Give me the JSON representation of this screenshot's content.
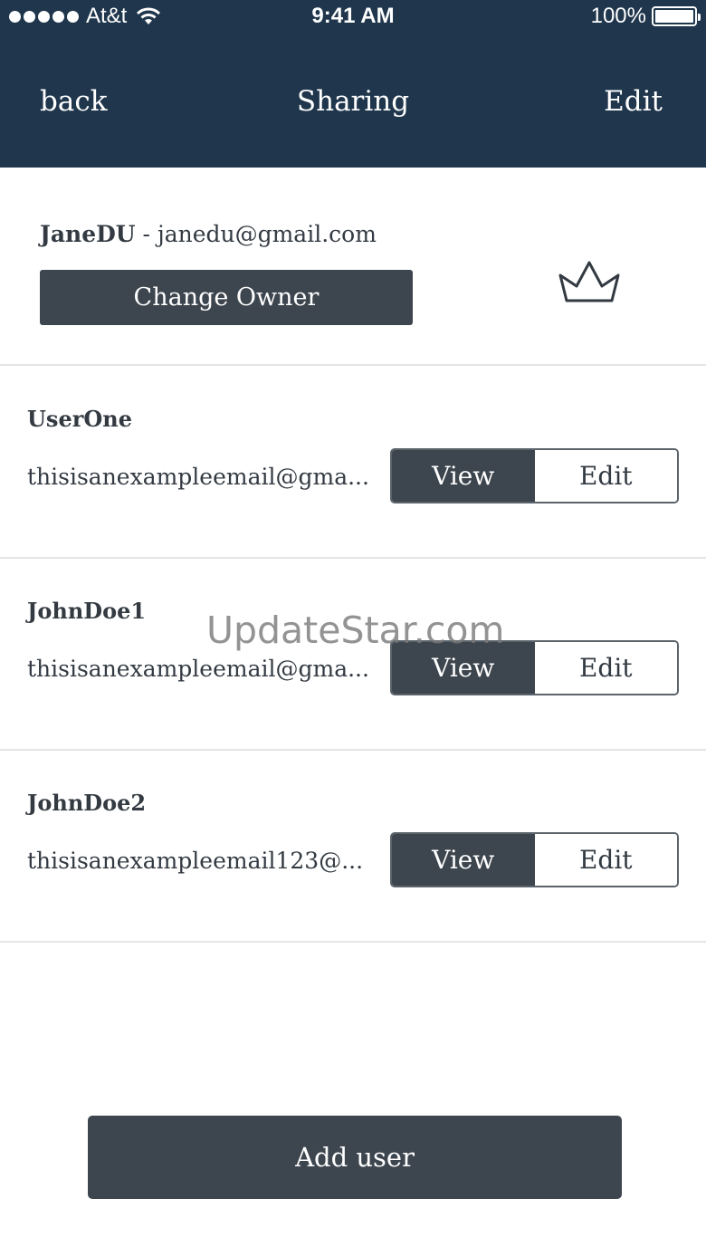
{
  "status_bar": {
    "carrier": "At&t",
    "time": "9:41 AM",
    "battery": "100%"
  },
  "nav": {
    "back_label": "back",
    "title": "Sharing",
    "edit_label": "Edit"
  },
  "owner": {
    "name": "JaneDU",
    "separator": " - ",
    "email": "janedu@gmail.com",
    "change_owner_label": "Change Owner",
    "icon": "crown-icon"
  },
  "users": [
    {
      "name": "UserOne",
      "email": "thisisanexampleemail@gma...",
      "view_label": "View",
      "edit_label": "Edit",
      "selected": "View"
    },
    {
      "name": "JohnDoe1",
      "email": "thisisanexampleemail@gma...",
      "view_label": "View",
      "edit_label": "Edit",
      "selected": "View"
    },
    {
      "name": "JohnDoe2",
      "email": "thisisanexampleemail123@...",
      "view_label": "View",
      "edit_label": "Edit",
      "selected": "View"
    }
  ],
  "watermark": "UpdateStar.com",
  "add_user_label": "Add user",
  "colors": {
    "header": "#1f364c",
    "button": "#3d454e",
    "divider": "#e3e5e7"
  }
}
